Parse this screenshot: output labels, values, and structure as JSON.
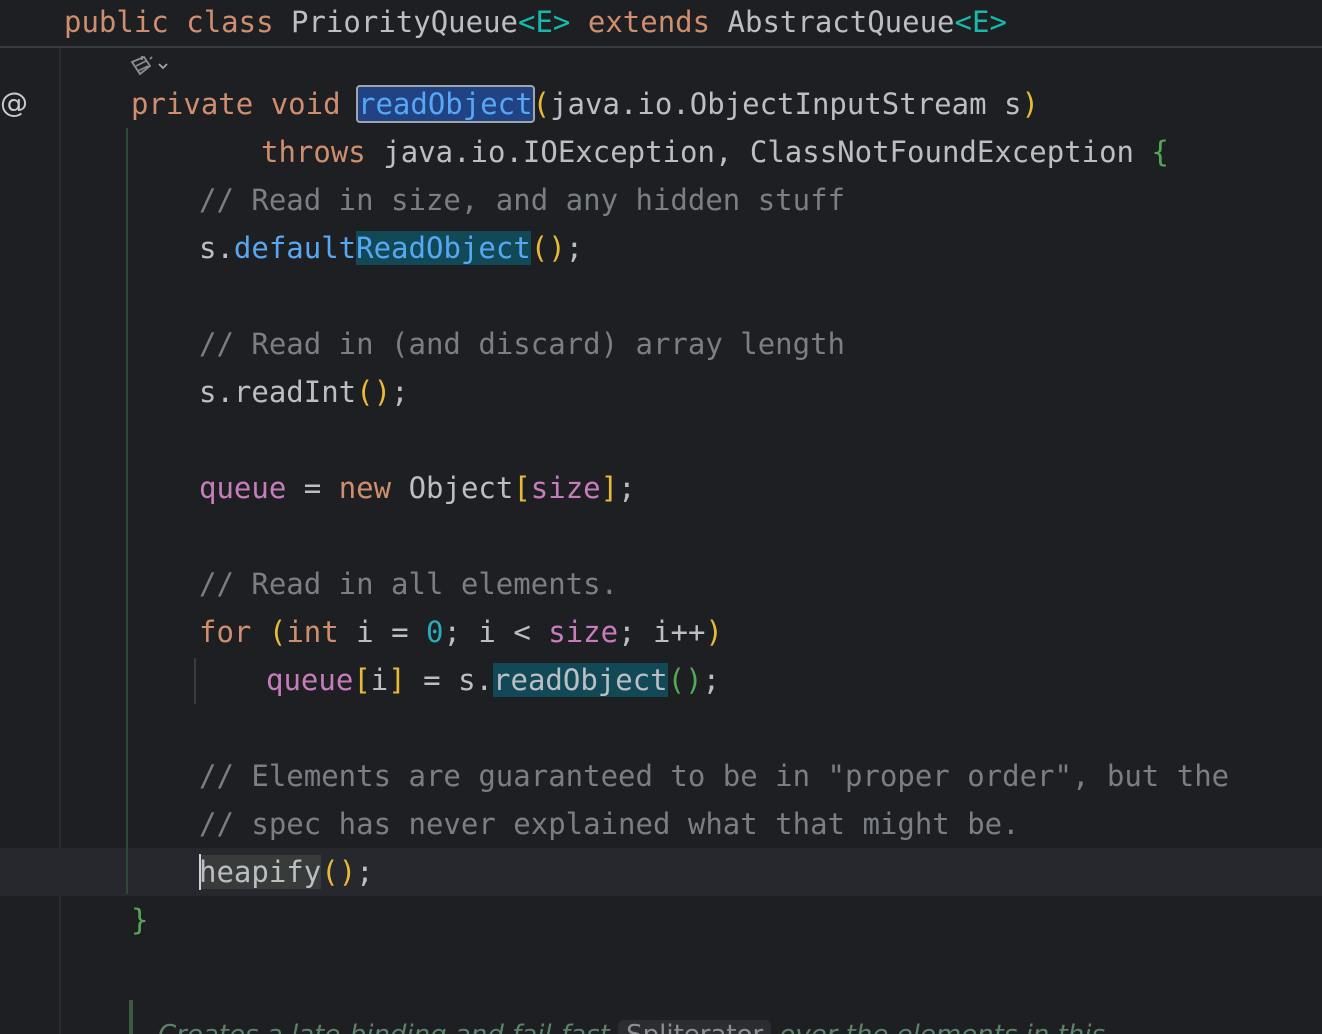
{
  "sticky_header": {
    "kw_public": "public",
    "kw_class": "class",
    "class_name": "PriorityQueue",
    "type_param_1": "<E>",
    "kw_extends": "extends",
    "super_name": "AbstractQueue",
    "type_param_2": "<E>"
  },
  "gutter": {
    "override_icon": "@"
  },
  "code": {
    "l1_private": "private",
    "l1_void": "void",
    "l1_method": "readObject",
    "l1_open": "(",
    "l1_params": "java.io.ObjectInputStream s",
    "l1_close": ")",
    "l2_throws": "throws",
    "l2_exceptions": "java.io.IOException, ClassNotFoundException",
    "l2_brace": "{",
    "l3_comment": "// Read in size, and any hidden stuff",
    "l4_recv": "s.",
    "l4_call_a": "default",
    "l4_call_b": "ReadObject",
    "l4_parens": "()",
    "l4_semi": ";",
    "l6_comment": "// Read in (and discard) array length",
    "l7_recv": "s.readInt",
    "l7_parens": "()",
    "l7_semi": ";",
    "l9_field": "queue",
    "l9_eq": " = ",
    "l9_new": "new",
    "l9_type": "Object",
    "l9_lb": "[",
    "l9_size": "size",
    "l9_rb": "]",
    "l9_semi": ";",
    "l11_comment": "// Read in all elements.",
    "l12_for": "for",
    "l12_open": "(",
    "l12_int": "int",
    "l12_i": " i = ",
    "l12_zero": "0",
    "l12_mid": "; i < ",
    "l12_size": "size",
    "l12_tail": "; i++",
    "l12_close": ")",
    "l13_field": "queue",
    "l13_lb": "[",
    "l13_i": "i",
    "l13_rb": "]",
    "l13_eq": " = s.",
    "l13_call": "readObject",
    "l13_parens": "()",
    "l13_semi": ";",
    "l15_comment": "// Elements are guaranteed to be in \"proper order\", but the",
    "l16_comment": "// spec has never explained what that might be.",
    "l17_call_first": "h",
    "l17_call_rest": "eapify",
    "l17_parens": "()",
    "l17_semi": ";",
    "l18_brace": "}"
  },
  "doc_comment": {
    "text_a": "Creates a ",
    "text_b": "late-binding",
    "text_c": " and ",
    "text_d": "fail-fast",
    "chip": "Spliterator",
    "text_e": " over the elements in this"
  },
  "colors": {
    "background": "#1e1f22",
    "keyword": "#cf8e6d",
    "comment": "#7a7e85",
    "field": "#c77dbb",
    "method_call": "#56a8f5",
    "number": "#2aacb8",
    "type_param": "#16baac",
    "usage_highlight": "#114957"
  }
}
